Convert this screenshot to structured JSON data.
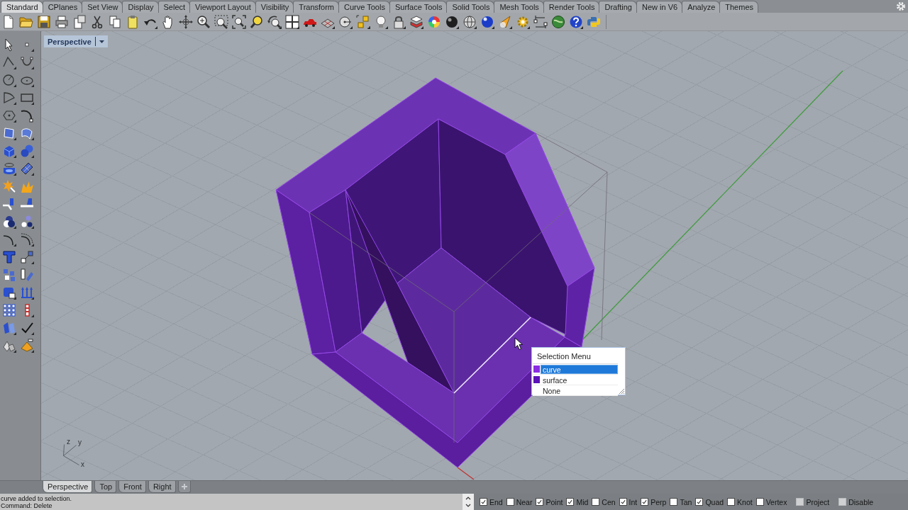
{
  "ribbon_tabs": [
    {
      "label": "Standard",
      "selected": true
    },
    {
      "label": "CPlanes",
      "selected": false
    },
    {
      "label": "Set View",
      "selected": false
    },
    {
      "label": "Display",
      "selected": false
    },
    {
      "label": "Select",
      "selected": false
    },
    {
      "label": "Viewport Layout",
      "selected": false
    },
    {
      "label": "Visibility",
      "selected": false
    },
    {
      "label": "Transform",
      "selected": false
    },
    {
      "label": "Curve Tools",
      "selected": false
    },
    {
      "label": "Surface Tools",
      "selected": false
    },
    {
      "label": "Solid Tools",
      "selected": false
    },
    {
      "label": "Mesh Tools",
      "selected": false
    },
    {
      "label": "Render Tools",
      "selected": false
    },
    {
      "label": "Drafting",
      "selected": false
    },
    {
      "label": "New in V6",
      "selected": false
    },
    {
      "label": "Analyze",
      "selected": false
    },
    {
      "label": "Themes",
      "selected": false
    }
  ],
  "viewport": {
    "title": "Perspective",
    "axis_labels": [
      "z",
      "y",
      "x"
    ]
  },
  "selection_menu": {
    "title": "Selection Menu",
    "items": [
      {
        "label": "curve",
        "selected": true,
        "color": "#8b2be2"
      },
      {
        "label": "surface",
        "selected": false,
        "color": "#5b12b8"
      },
      {
        "label": "None",
        "selected": false
      }
    ]
  },
  "viewport_tabs": [
    {
      "label": "Perspective",
      "selected": true
    },
    {
      "label": "Top",
      "selected": false
    },
    {
      "label": "Front",
      "selected": false
    },
    {
      "label": "Right",
      "selected": false
    }
  ],
  "command_history": [
    "curve added to selection."
  ],
  "command_prompt": "Command: Delete",
  "osnaps": [
    {
      "label": "End",
      "checked": true,
      "disabled": false
    },
    {
      "label": "Near",
      "checked": false,
      "disabled": false
    },
    {
      "label": "Point",
      "checked": true,
      "disabled": false
    },
    {
      "label": "Mid",
      "checked": true,
      "disabled": false
    },
    {
      "label": "Cen",
      "checked": false,
      "disabled": false
    },
    {
      "label": "Int",
      "checked": true,
      "disabled": false
    },
    {
      "label": "Perp",
      "checked": true,
      "disabled": false
    },
    {
      "label": "Tan",
      "checked": false,
      "disabled": false
    },
    {
      "label": "Quad",
      "checked": true,
      "disabled": false
    },
    {
      "label": "Knot",
      "checked": false,
      "disabled": false
    },
    {
      "label": "Vertex",
      "checked": false,
      "disabled": false
    },
    {
      "label": "Project",
      "checked": false,
      "disabled": true
    },
    {
      "label": "Disable",
      "checked": false,
      "disabled": true
    }
  ]
}
